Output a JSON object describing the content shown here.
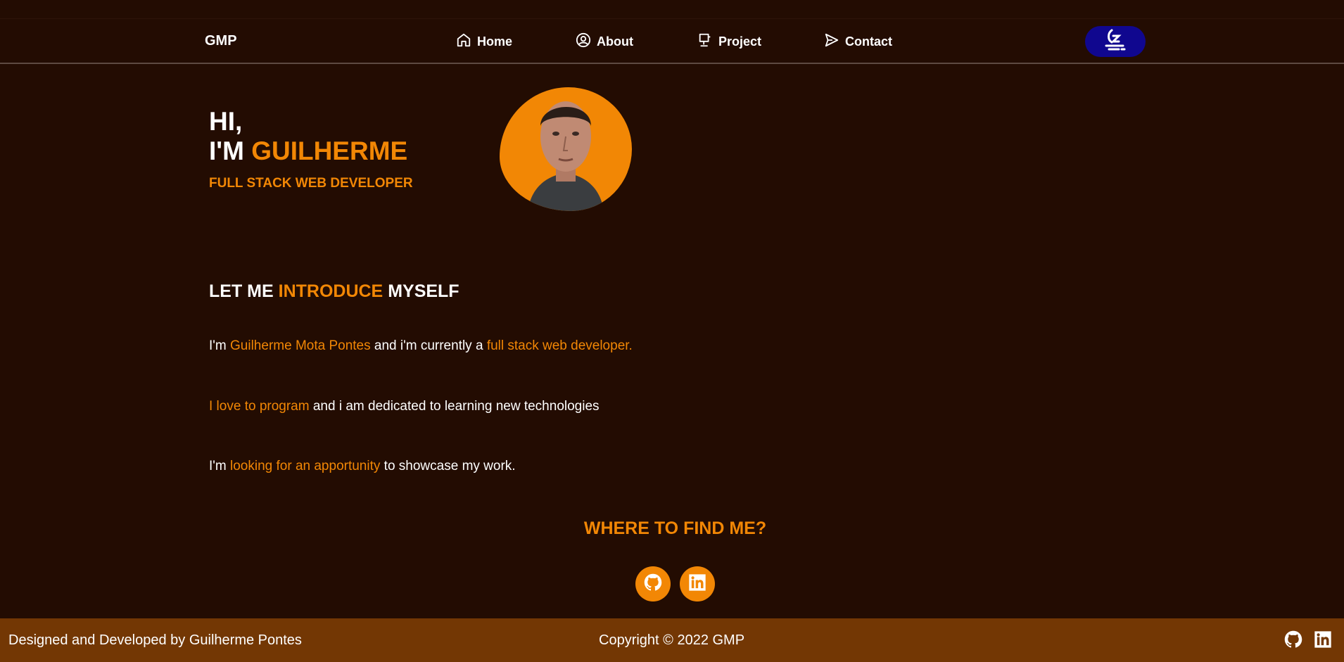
{
  "nav": {
    "brand": "GMP",
    "items": [
      {
        "label": "Home",
        "icon": "home-icon"
      },
      {
        "label": "About",
        "icon": "user-circle-icon"
      },
      {
        "label": "Project",
        "icon": "presentation-icon"
      },
      {
        "label": "Contact",
        "icon": "send-icon"
      }
    ],
    "theme_toggle_icon": "moon-sleep-icon"
  },
  "hero": {
    "greeting": "HI,",
    "im": "I'M",
    "name": "GUILHERME",
    "subtitle": "FULL STACK WEB DEVELOPER"
  },
  "intro": {
    "title_prefix": "LET ME",
    "title_highlight": "INTRODUCE",
    "title_suffix": "MYSELF",
    "p1_a": "I'm",
    "p1_b": "Guilherme Mota Pontes",
    "p1_c": "and i'm currently a",
    "p1_d": "full stack web developer.",
    "p2_a": "I love to program",
    "p2_b": "and i am dedicated to learning new technologies",
    "p3_a": "I'm",
    "p3_b": "looking for an apportunity",
    "p3_c": "to showcase my work."
  },
  "find": {
    "title": "WHERE TO FIND ME?",
    "links": [
      "github-icon",
      "linkedin-icon"
    ]
  },
  "footer": {
    "left": "Designed and Developed by Guilherme Pontes",
    "center": "Copyright © 2022 GMP"
  },
  "colors": {
    "background": "#230c02",
    "accent": "#f28705",
    "footer": "#733704",
    "toggle": "#10078f"
  }
}
